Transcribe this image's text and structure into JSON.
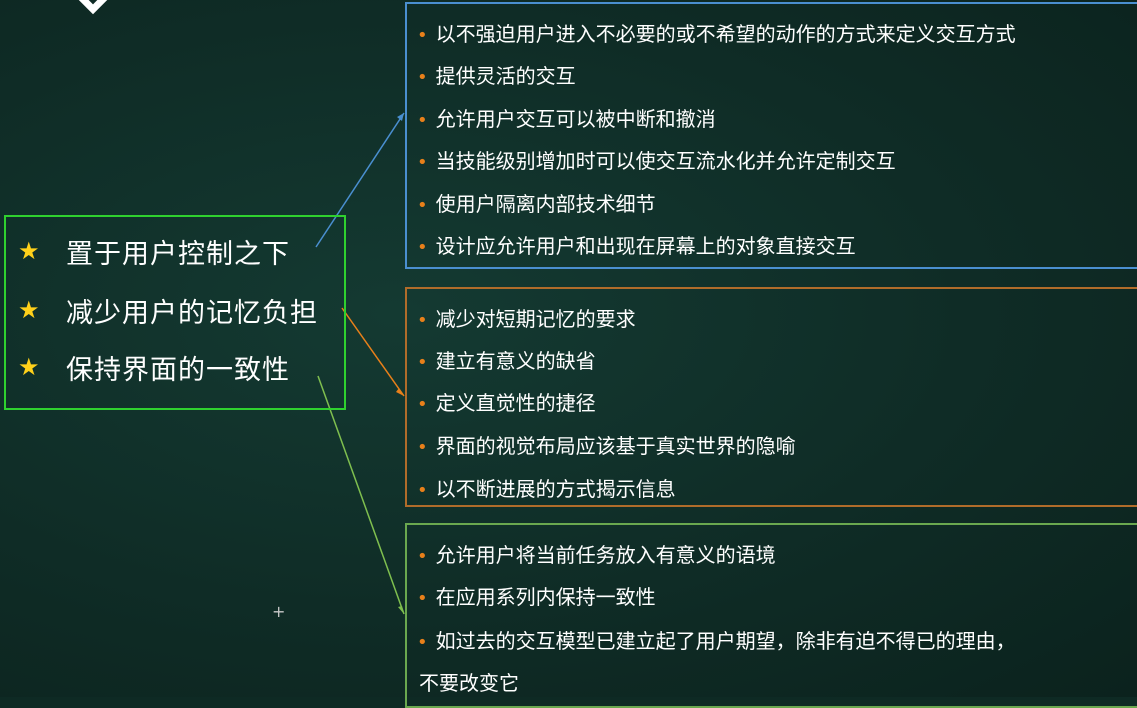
{
  "principles": [
    {
      "label": "置于用户控制之下"
    },
    {
      "label": "减少用户的记忆负担"
    },
    {
      "label": "保持界面的一致性"
    }
  ],
  "groups": [
    {
      "color": "#4a8fd0",
      "items": [
        "以不强迫用户进入不必要的或不希望的动作的方式来定义交互方式",
        "提供灵活的交互",
        "允许用户交互可以被中断和撤消",
        "当技能级别增加时可以使交互流水化并允许定制交互",
        "使用户隔离内部技术细节",
        "设计应允许用户和出现在屏幕上的对象直接交互"
      ]
    },
    {
      "color": "#b06c2a",
      "items": [
        "减少对短期记忆的要求",
        "建立有意义的缺省",
        "定义直觉性的捷径",
        "界面的视觉布局应该基于真实世界的隐喻",
        "以不断进展的方式揭示信息"
      ]
    },
    {
      "color": "#6aa84f",
      "items": [
        "允许用户将当前任务放入有意义的语境",
        "在应用系列内保持一致性",
        "如过去的交互模型已建立起了用户期望，除非有迫不得已的理由，"
      ],
      "continuation": "不要改变它"
    }
  ],
  "icons": {
    "star": "★",
    "bullet": "•"
  }
}
